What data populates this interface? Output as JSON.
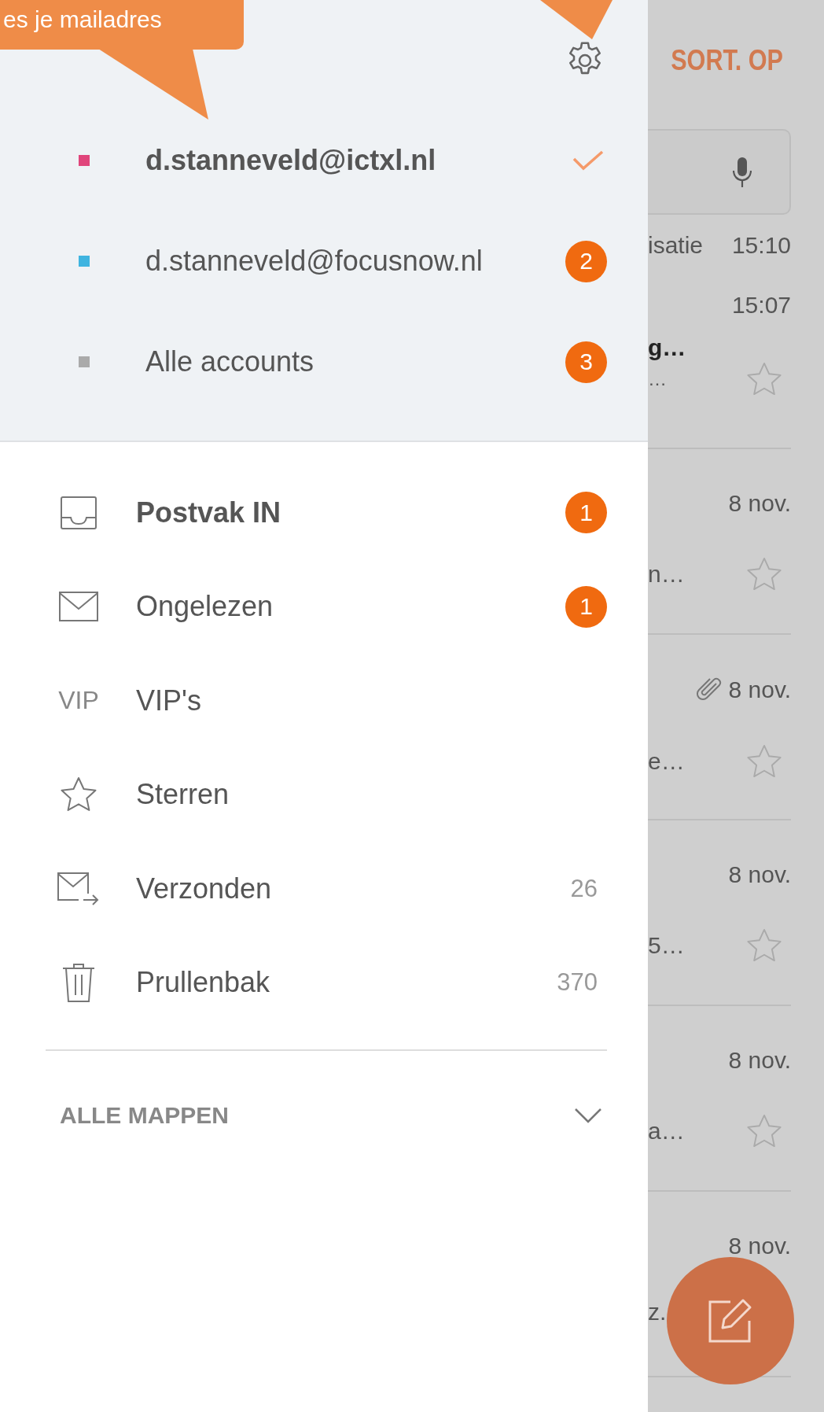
{
  "callout": {
    "text": "es je mailadres"
  },
  "accounts": [
    {
      "email": "d.stanneveld@ictxl.nl",
      "color": "#e0457b",
      "selected": true
    },
    {
      "email": "d.stanneveld@focusnow.nl",
      "color": "#3fb4e0",
      "selected": false,
      "badge": "2"
    },
    {
      "email": "Alle accounts",
      "color": "#aaaaaa",
      "selected": false,
      "badge": "3"
    }
  ],
  "folders": [
    {
      "kind": "inbox",
      "label": "Postvak IN",
      "unread": true,
      "badge": "1"
    },
    {
      "kind": "envelope",
      "label": "Ongelezen",
      "unread": false,
      "badge": "1"
    },
    {
      "kind": "vip",
      "icon_text": "VIP",
      "label": "VIP's",
      "unread": false
    },
    {
      "kind": "star",
      "label": "Sterren",
      "unread": false
    },
    {
      "kind": "sent",
      "label": "Verzonden",
      "unread": false,
      "count": "26"
    },
    {
      "kind": "trash",
      "label": "Prullenbak",
      "unread": false,
      "count": "370"
    }
  ],
  "all_folders": {
    "label": "ALLE MAPPEN",
    "expanded": false
  },
  "message_list": {
    "sort_label": "SORT. OP",
    "top": [
      {
        "kind": "line",
        "sender": "isatie",
        "time": "15:10"
      },
      {
        "kind": "message",
        "time": "15:07",
        "subject": "g…",
        "preview": "…",
        "starred": false
      }
    ],
    "messages": [
      {
        "time": "8 nov.",
        "preview": "n…",
        "attachment": false,
        "starred": false
      },
      {
        "time": "8 nov.",
        "preview": "e…",
        "attachment": true,
        "starred": false
      },
      {
        "time": "8 nov.",
        "preview": "5…",
        "attachment": false,
        "starred": false
      },
      {
        "time": "8 nov.",
        "preview": "a…",
        "attachment": false,
        "starred": false
      },
      {
        "time": "8 nov.",
        "preview": "z."
      }
    ]
  }
}
